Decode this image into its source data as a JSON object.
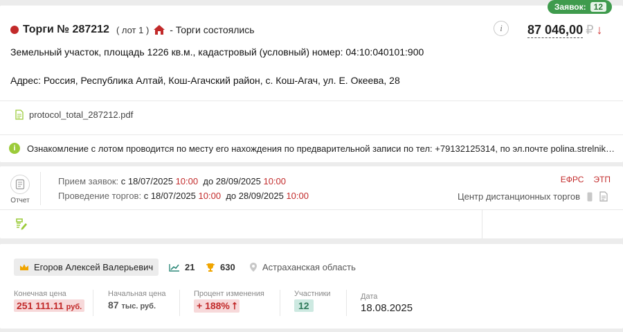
{
  "lot": {
    "bids_label": "Заявок:",
    "bids_count": "12",
    "title": "Торги № 287212",
    "lot_label": "( лот 1 )",
    "status": "- Торги состоялись",
    "price": "87 046,00",
    "currency": "₽",
    "price_arrow": "↓",
    "info_glyph": "i",
    "description": "Земельный участок, площадь 1226 кв.м., кадастровый (условный) номер: 04:10:040101:900",
    "address": "Адрес: Россия, Республика Алтай, Кош-Агачский район, с. Кош-Агач, ул. Е. Океева, 28",
    "file_name": "protocol_total_287212.pdf",
    "notice_glyph": "i",
    "notice": "Ознакомление с лотом проводится по месту его нахождения по предварительной записи по тел: +79132125314, по эл.почте polina.strelnikova@mail.ru"
  },
  "schedule": {
    "report_label": "Отчет",
    "applications": {
      "label": "Прием заявок:",
      "from": "с 18/07/2025",
      "from_time": "10:00",
      "to": "до 28/09/2025",
      "to_time": "10:00"
    },
    "auction": {
      "label": "Проведение торгов:",
      "from": "с 18/07/2025",
      "from_time": "10:00",
      "to": "до 28/09/2025",
      "to_time": "10:00"
    },
    "link_efrs": "ЕФРС",
    "link_etp": "ЭТП",
    "platform": "Центр дистанционных торгов"
  },
  "result": {
    "winner": "Егоров Алексей Валерьевич",
    "stat_trend": "21",
    "stat_trophy": "630",
    "region": "Астраханская область",
    "final_price_label": "Конечная цена",
    "final_price": "251 111.11",
    "final_price_unit": "руб.",
    "start_price_label": "Начальная цена",
    "start_price": "87",
    "start_price_unit": "тыс. руб.",
    "change_label": "Процент изменения",
    "change_value": "+ 188% ⭡",
    "participants_label": "Участники",
    "participants": "12",
    "date_label": "Дата",
    "date": "18.08.2025"
  },
  "colors": {
    "accent_red": "#c22a2a",
    "accent_green": "#3f9b4d"
  },
  "icons": [
    "red-status-dot",
    "house-icon",
    "info-icon",
    "arrow-down-icon",
    "pdf-file-icon",
    "notice-info-icon",
    "report-icon",
    "edit-document-icon",
    "phone-icon",
    "document-icon",
    "crown-icon",
    "trend-chart-icon",
    "trophy-icon",
    "location-pin-icon"
  ]
}
